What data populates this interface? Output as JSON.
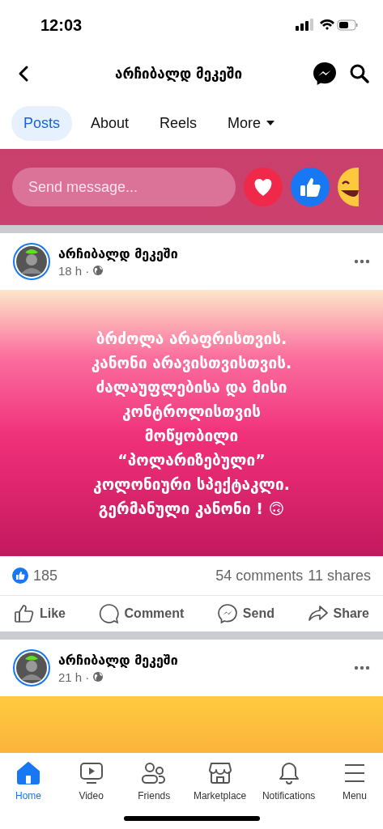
{
  "status_bar": {
    "time": "12:03"
  },
  "header": {
    "title": "არჩიბალდ მეკეში"
  },
  "tabs": [
    {
      "label": "Posts",
      "selected": true,
      "dropdown": false
    },
    {
      "label": "About",
      "selected": false,
      "dropdown": false
    },
    {
      "label": "Reels",
      "selected": false,
      "dropdown": false
    },
    {
      "label": "More",
      "selected": false,
      "dropdown": true
    }
  ],
  "message_bar": {
    "placeholder": "Send message..."
  },
  "posts": [
    {
      "author": "არჩიბალდ მეკეში",
      "time": "18 h",
      "separator": "·",
      "lines": [
        "ბრძოლა არაფრისთვის.",
        "კანონი არავისთვისთვის.",
        "ძალაუფლებისა და მისი",
        "კონტროლისთვის",
        "მოწყობილი",
        "“პოლარიზებული”",
        "კოლონიური სპექტაკლი.",
        "გერმანული კანონი ! 🙃"
      ],
      "likes": "185",
      "comments": "54 comments",
      "shares": "11 shares",
      "actions": [
        "Like",
        "Comment",
        "Send",
        "Share"
      ]
    },
    {
      "author": "არჩიბალდ მეკეში",
      "time": "21 h",
      "separator": "·"
    }
  ],
  "bottom_nav": [
    {
      "label": "Home",
      "selected": true,
      "kind": "home"
    },
    {
      "label": "Video",
      "selected": false,
      "kind": "video"
    },
    {
      "label": "Friends",
      "selected": false,
      "kind": "friends"
    },
    {
      "label": "Marketplace",
      "selected": false,
      "kind": "marketplace"
    },
    {
      "label": "Notifications",
      "selected": false,
      "kind": "notifications"
    },
    {
      "label": "Menu",
      "selected": false,
      "kind": "menu"
    }
  ]
}
